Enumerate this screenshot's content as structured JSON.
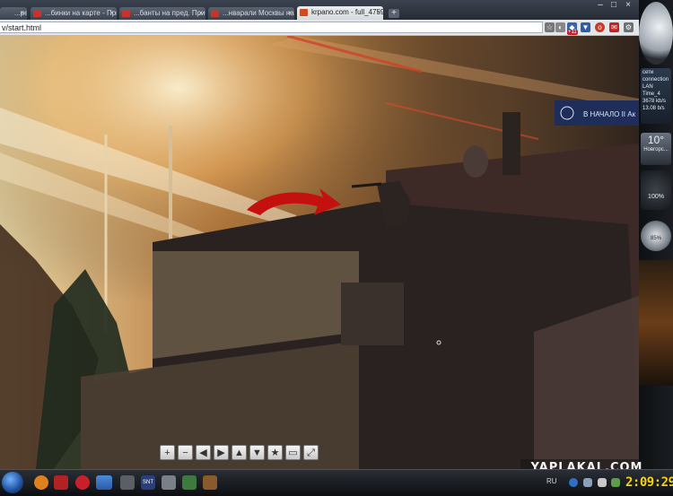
{
  "tabs": [
    {
      "label": "...рематы...",
      "active": false
    },
    {
      "label": "...бинки на карте - Прибл...",
      "active": false
    },
    {
      "label": "...банты на пред. Прие...",
      "active": false
    },
    {
      "label": "...нварали Москвы на со...",
      "active": false
    },
    {
      "label": "krpano.com - full_47593x...",
      "active": true
    }
  ],
  "new_tab_label": "+",
  "window_controls": {
    "minimize": "–",
    "maximize": "□",
    "close": "×"
  },
  "address_bar": {
    "value": "v/start.html"
  },
  "toolbar_badge": "+11",
  "scene_sign": "В НАЧАЛО II Ак",
  "nav_buttons": [
    {
      "name": "zoom-in-button",
      "icon": "+"
    },
    {
      "name": "zoom-out-button",
      "icon": "−"
    },
    {
      "name": "pan-left-button",
      "icon": "◀"
    },
    {
      "name": "pan-right-button",
      "icon": "▶"
    },
    {
      "name": "pan-up-button",
      "icon": "▲"
    },
    {
      "name": "pan-down-button",
      "icon": "▼"
    },
    {
      "name": "autorotate-button",
      "icon": "★"
    },
    {
      "name": "hotspot-button",
      "icon": "▭"
    },
    {
      "name": "fullscreen-button",
      "icon": "⤢"
    }
  ],
  "gadgets": {
    "network": {
      "line1": "сети",
      "line2": "connection",
      "line3": "LAN",
      "line4": "Time_4",
      "line5": "3678 kb/s",
      "line6": "13.08 b/s"
    },
    "weather": {
      "temp": "10°",
      "city": "Новгорс..."
    },
    "cpu": {
      "percent": "100%"
    },
    "meter": {
      "percent": "85%"
    }
  },
  "taskbar": {
    "lang": "RU",
    "clock": "2:09:29"
  },
  "watermark": "YAPLAKAL.COM",
  "colors": {
    "accent_arrow": "#c4100f",
    "clock": "#f3d11c"
  }
}
